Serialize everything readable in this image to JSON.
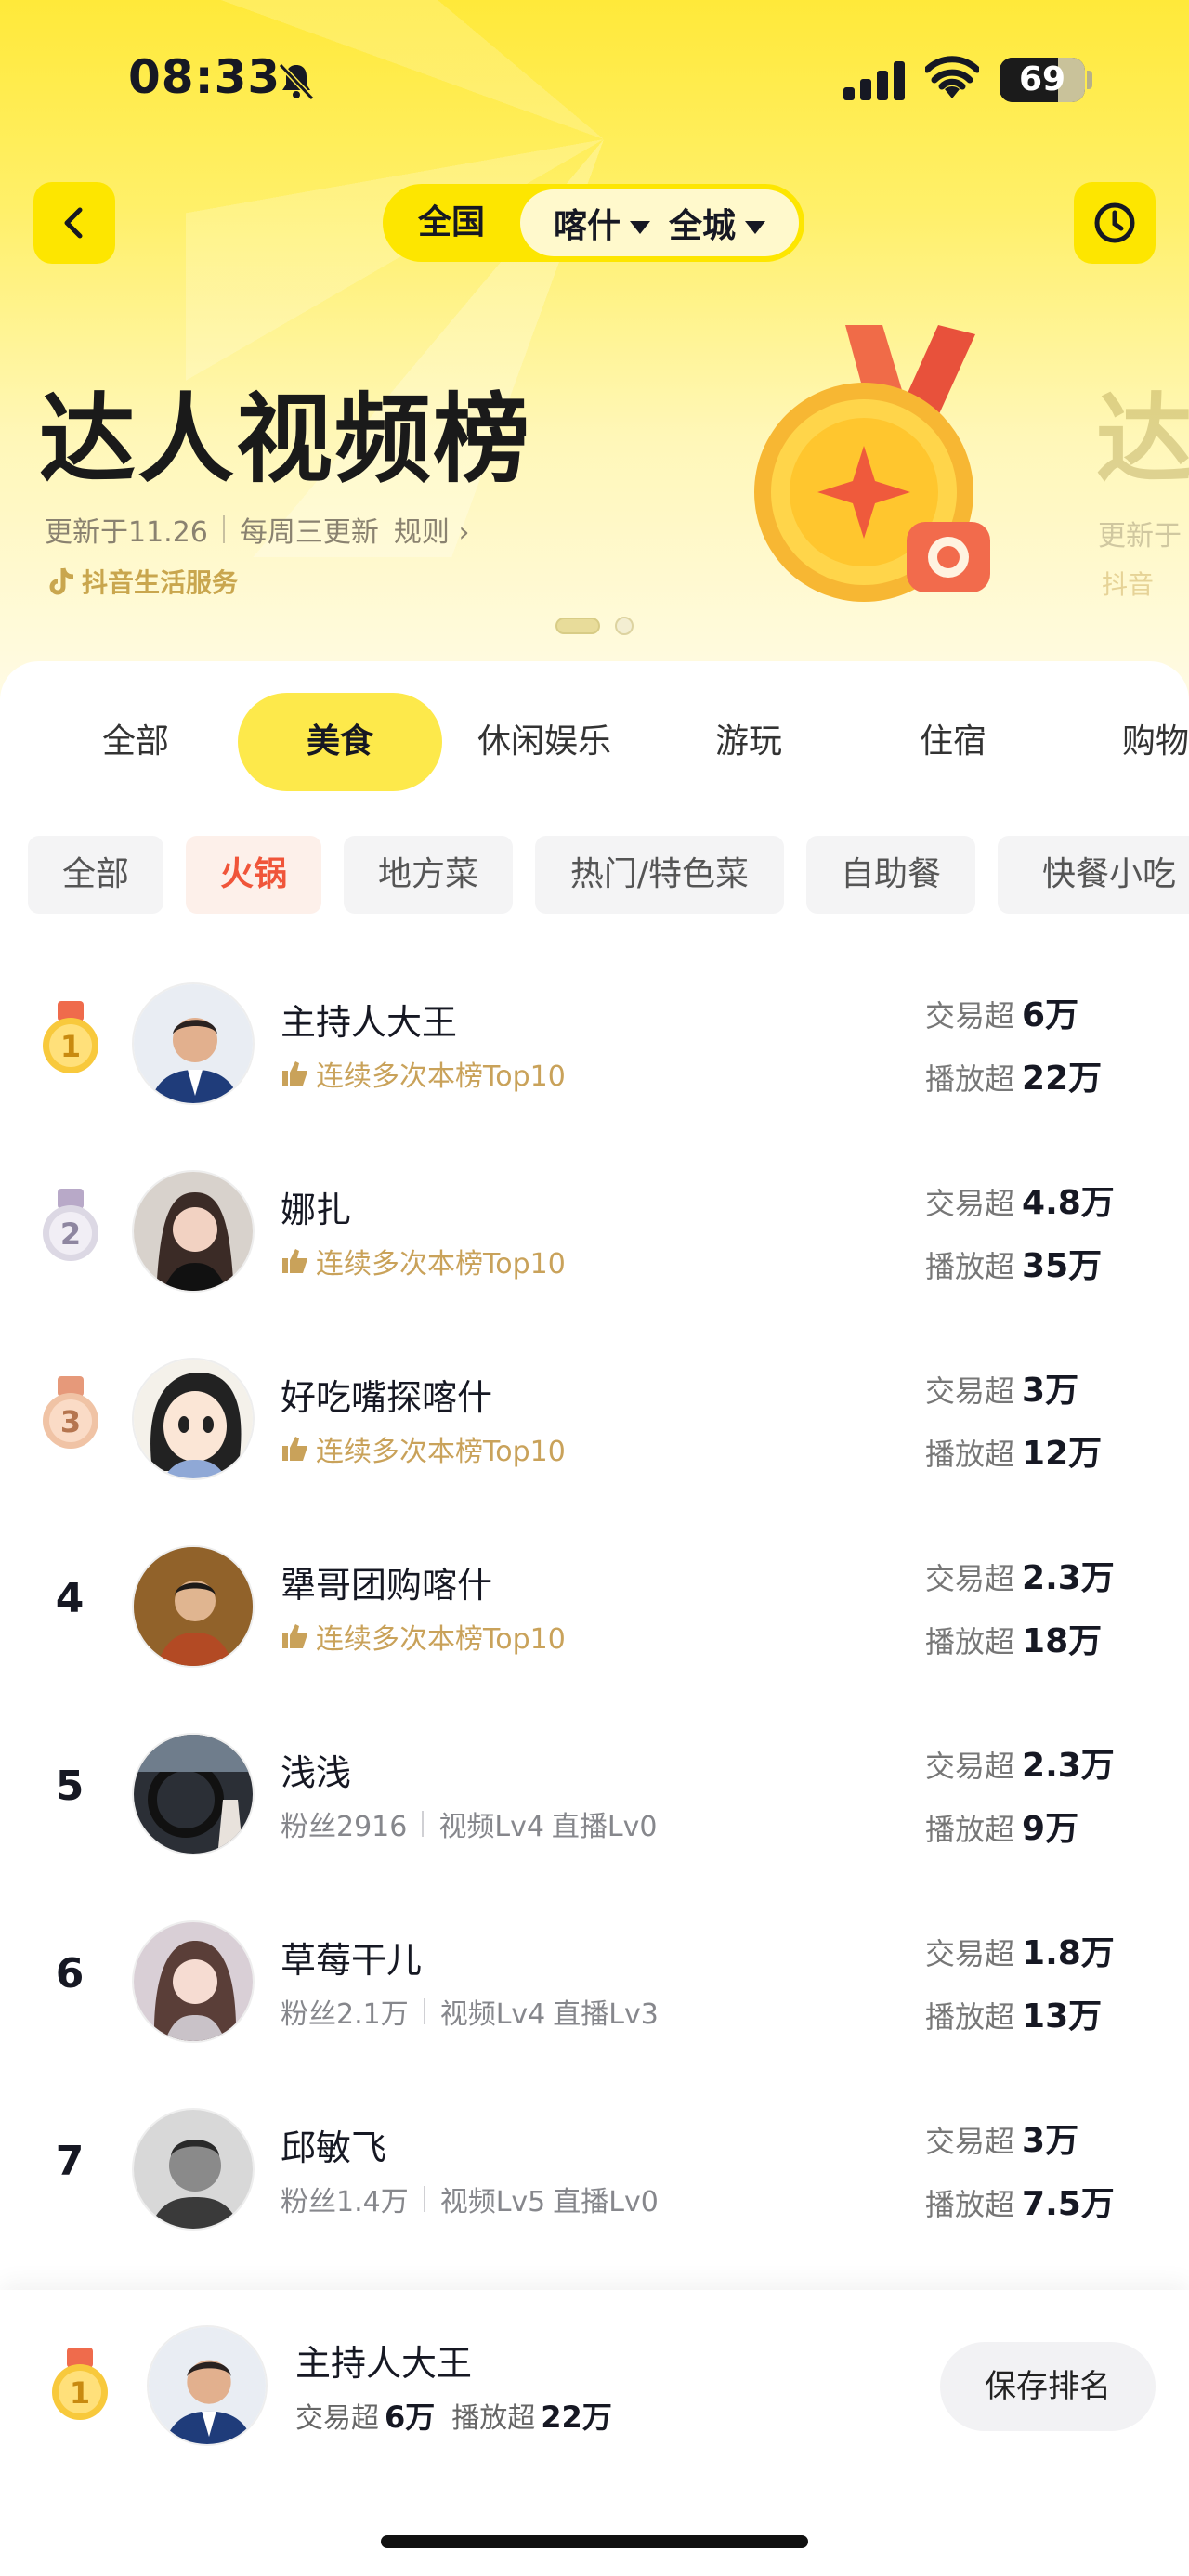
{
  "status": {
    "time": "08:33",
    "battery": "69",
    "battery_level": 0.69
  },
  "nav": {
    "region_nation": "全国",
    "region_city": "喀什",
    "region_district": "全城"
  },
  "hero": {
    "title": "达人视频榜",
    "updated": "更新于11.26",
    "schedule": "每周三更新",
    "rules": "规则",
    "brand": "抖音生活服务",
    "ghost_title": "达",
    "ghost_meta": "更新于",
    "ghost_brand": "抖音"
  },
  "category_tabs": [
    "全部",
    "美食",
    "休闲娱乐",
    "游玩",
    "住宿",
    "购物"
  ],
  "sub_tabs": [
    "全部",
    "火锅",
    "地方菜",
    "热门/特色菜",
    "自助餐",
    "快餐小吃"
  ],
  "labels": {
    "deal": "交易超",
    "play": "播放超",
    "honor": "连续多次本榜Top10"
  },
  "list": [
    {
      "rank": "1",
      "name": "主持人大王",
      "honor": true,
      "deal": "6万",
      "play": "22万"
    },
    {
      "rank": "2",
      "name": "娜扎",
      "honor": true,
      "deal": "4.8万",
      "play": "35万"
    },
    {
      "rank": "3",
      "name": "好吃嘴探喀什",
      "honor": true,
      "deal": "3万",
      "play": "12万"
    },
    {
      "rank": "4",
      "name": "犟哥团购喀什",
      "honor": true,
      "deal": "2.3万",
      "play": "18万"
    },
    {
      "rank": "5",
      "name": "浅浅",
      "fans": "粉丝2916",
      "video": "视频Lv4",
      "live": "直播Lv0",
      "deal": "2.3万",
      "play": "9万"
    },
    {
      "rank": "6",
      "name": "草莓干儿",
      "fans": "粉丝2.1万",
      "video": "视频Lv4",
      "live": "直播Lv3",
      "deal": "1.8万",
      "play": "13万"
    },
    {
      "rank": "7",
      "name": "邱敏飞",
      "fans": "粉丝1.4万",
      "video": "视频Lv5",
      "live": "直播Lv0",
      "deal": "3万",
      "play": "7.5万"
    }
  ],
  "me": {
    "rank": "1",
    "name": "主持人大王",
    "deal": "6万",
    "play": "22万",
    "save_label": "保存排名"
  },
  "colors": {
    "accent": "#fde600",
    "honor": "#c9a25a",
    "sub_active": "#f0553a"
  }
}
